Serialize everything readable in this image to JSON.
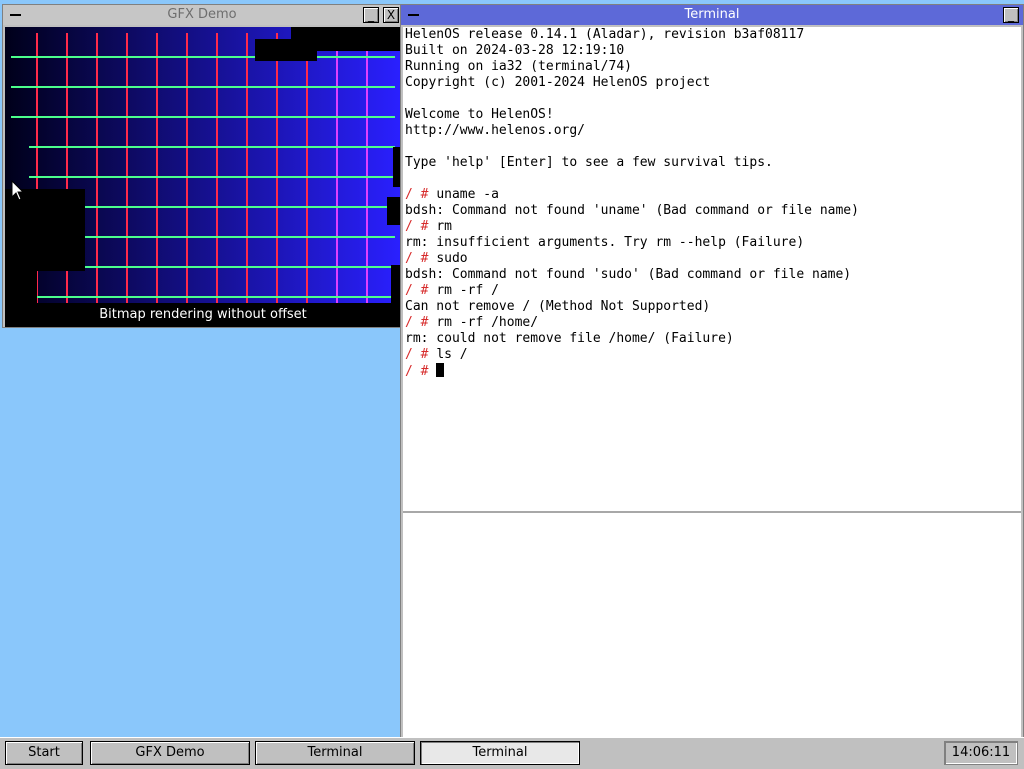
{
  "gfx_window": {
    "title": "GFX Demo",
    "minimize_glyph": "_",
    "close_glyph": "X",
    "caption": "Bitmap rendering without offset",
    "colors": {
      "background_left": "#00001a",
      "background_right": "#2a20ff",
      "grid_horizontal": "#4cff8c",
      "grid_vertical": "#ff2a4a"
    }
  },
  "terminal_window": {
    "title": "Terminal",
    "minimize_glyph": "_",
    "lines": [
      {
        "prompt": "",
        "text": "HelenOS release 0.14.1 (Aladar), revision b3af08117"
      },
      {
        "prompt": "",
        "text": "Built on 2024-03-28 12:19:10"
      },
      {
        "prompt": "",
        "text": "Running on ia32 (terminal/74)"
      },
      {
        "prompt": "",
        "text": "Copyright (c) 2001-2024 HelenOS project"
      },
      {
        "prompt": "",
        "text": ""
      },
      {
        "prompt": "",
        "text": "Welcome to HelenOS!"
      },
      {
        "prompt": "",
        "text": "http://www.helenos.org/"
      },
      {
        "prompt": "",
        "text": ""
      },
      {
        "prompt": "",
        "text": "Type 'help' [Enter] to see a few survival tips."
      },
      {
        "prompt": "",
        "text": ""
      },
      {
        "prompt": "/ # ",
        "text": "uname -a"
      },
      {
        "prompt": "",
        "text": "bdsh: Command not found 'uname' (Bad command or file name)"
      },
      {
        "prompt": "/ # ",
        "text": "rm"
      },
      {
        "prompt": "",
        "text": "rm: insufficient arguments. Try rm --help (Failure)"
      },
      {
        "prompt": "/ # ",
        "text": "sudo"
      },
      {
        "prompt": "",
        "text": "bdsh: Command not found 'sudo' (Bad command or file name)"
      },
      {
        "prompt": "/ # ",
        "text": "rm -rf /"
      },
      {
        "prompt": "",
        "text": "Can not remove / (Method Not Supported)"
      },
      {
        "prompt": "/ # ",
        "text": "rm -rf /home/"
      },
      {
        "prompt": "",
        "text": "rm: could not remove file /home/ (Failure)"
      },
      {
        "prompt": "/ # ",
        "text": "ls /"
      },
      {
        "prompt": "/ # ",
        "text": "",
        "cursor": true
      }
    ],
    "colors": {
      "prompt": "#d72b2b",
      "text": "#000000",
      "background": "#ffffff"
    }
  },
  "taskbar": {
    "start_label": "Start",
    "buttons": [
      {
        "label": "GFX Demo",
        "pressed": false
      },
      {
        "label": "Terminal",
        "pressed": false
      },
      {
        "label": "Terminal",
        "pressed": true
      }
    ],
    "clock": "14:06:11"
  },
  "desktop": {
    "background": "#8ac7fb"
  },
  "icons": {
    "mouse_pointer": "arrow-cursor-icon",
    "window_menu": "window-menu-icon"
  }
}
